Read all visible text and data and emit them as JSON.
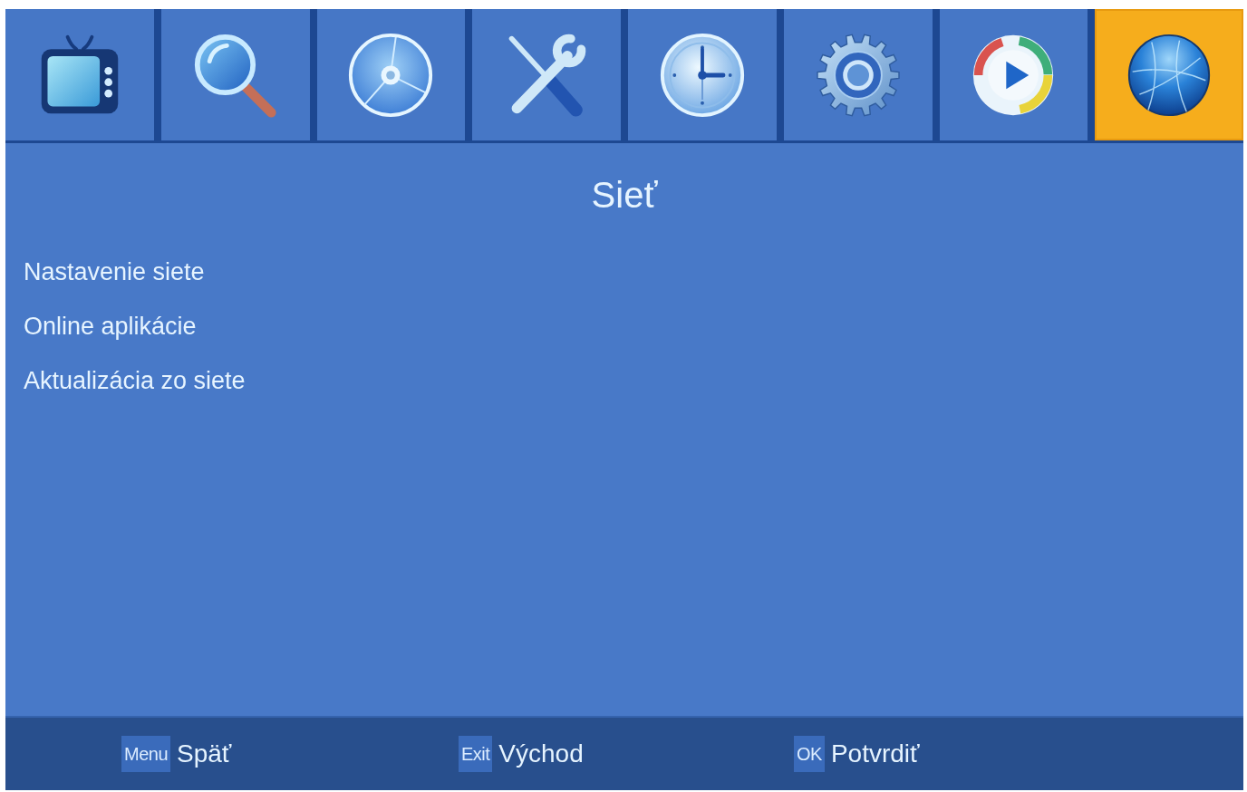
{
  "tabs": [
    {
      "kind": "tv",
      "selected": false
    },
    {
      "kind": "search",
      "selected": false
    },
    {
      "kind": "disc",
      "selected": false
    },
    {
      "kind": "tools",
      "selected": false
    },
    {
      "kind": "clock",
      "selected": false
    },
    {
      "kind": "gear",
      "selected": false
    },
    {
      "kind": "play",
      "selected": false
    },
    {
      "kind": "globe",
      "selected": true
    }
  ],
  "title": "Sieť",
  "menu_items": [
    "Nastavenie siete",
    "Online aplikácie",
    "Aktualizácia zo siete"
  ],
  "footer_hints": [
    {
      "key": "Menu",
      "label": "Späť"
    },
    {
      "key": "Exit",
      "label": "Východ"
    },
    {
      "key": "OK",
      "label": "Potvrdiť"
    }
  ]
}
